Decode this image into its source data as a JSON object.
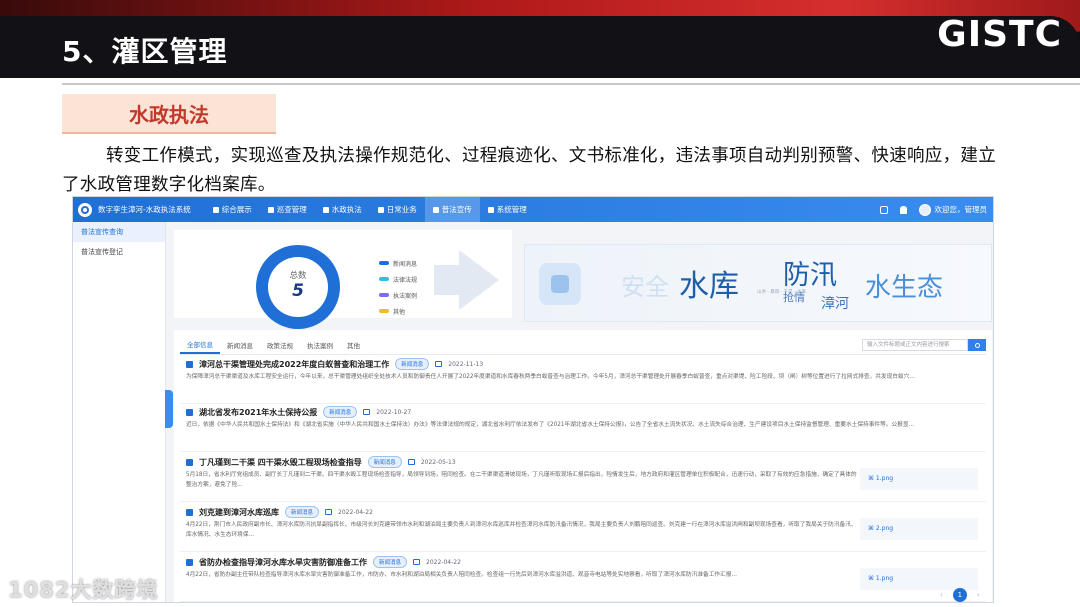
{
  "slide": {
    "title": "5、灌区管理",
    "logo": "GISTC",
    "section_label": "水政执法",
    "description": "转变工作模式，实现巡查及执法操作规范化、过程痕迹化、文书标准化，违法事项自动判别预警、快速响应，建立了水政管理数字化档案库。",
    "watermark": "1082大数跨境"
  },
  "app": {
    "title": "数字孪生漳河-水政执法系统",
    "nav": [
      {
        "label": "综合展示",
        "icon": "grid-icon"
      },
      {
        "label": "巡查管理",
        "icon": "location-icon"
      },
      {
        "label": "水政执法",
        "icon": "shield-icon"
      },
      {
        "label": "日常业务",
        "icon": "briefcase-icon"
      },
      {
        "label": "普法宣传",
        "icon": "megaphone-icon"
      },
      {
        "label": "系统管理",
        "icon": "gear-icon"
      }
    ],
    "active_nav": 4,
    "user_label": "欢迎您，管理员",
    "sidebar": [
      {
        "label": "普法宣传查询"
      },
      {
        "label": "普法宣传登记"
      }
    ]
  },
  "stats": {
    "total_label": "总数",
    "total_value": "5",
    "legend": [
      {
        "label": "新闻消息",
        "color": "#1f6fd6"
      },
      {
        "label": "法律法规",
        "color": "#3bb8e8"
      },
      {
        "label": "执法案例",
        "color": "#7a6ee8"
      },
      {
        "label": "其他",
        "color": "#f5b82e"
      }
    ]
  },
  "banner": {
    "words": [
      "安全",
      "水库",
      "防汛",
      "山洪 · 暴雨 · 干旱 · 水库",
      "抢情",
      "漳河",
      "水生态"
    ]
  },
  "list": {
    "tabs": [
      "全部信息",
      "新闻消息",
      "政策法规",
      "执法案例",
      "其他"
    ],
    "active_tab": 0,
    "search_placeholder": "输入文件标题或正文内容进行搜索",
    "items": [
      {
        "title": "漳河总干渠管理处完成2022年度白蚁普查和治理工作",
        "tag": "新闻消息",
        "date": "2022-11-13",
        "body": "为保障漳河总干渠渠道及水库工程安全运行，今年以来，总干渠管理处组织全处技术人员和防御责任人开展了2022年度渠道和水库春秋两季白蚁普查与治理工作。今年5月，漳河总干渠管理处开展春季白蚁普查，重点对渠堤、险工险段、坝（闸）树等位置进行了拉网式排查，共发现白蚁穴...",
        "attachment": ""
      },
      {
        "title": "湖北省发布2021年水土保持公报",
        "tag": "新闻消息",
        "date": "2022-10-27",
        "body": "近日，依据《中华人民共和国水土保持法》和《湖北省实施〈中华人民共和国水土保持法〉办法》等法律法规的规定，湖北省水利厅依法发布了《2021年湖北省水土保持公报》，公告了全省水土流失状况、水土流失综合治理、生产建设项目水土保持监督管理、重要水土保持事件等。公报显...",
        "attachment": ""
      },
      {
        "title": "丁凡瑾到二干渠 四干渠水毁工程现场检查指导",
        "tag": "新闻消息",
        "date": "2022-05-13",
        "body": "5月18日，省水利厅党组成员、副厅长丁凡瑾到二干渠、四干渠水毁工程现场检查指导，局领导到场，陪同检查。在二干渠渠道滑坡现场，丁凡瑾听取现场汇报后指出，险情发生后，地方政府和灌区管理单位积极配合，迅速行动，采取了有效的应急措施，确定了具体的整治方案，避免了险...",
        "attachment": "1.png"
      },
      {
        "title": "刘克建到漳河水库巡库",
        "tag": "新闻消息",
        "date": "2022-04-22",
        "body": "4月22日，荆门市人民政府副市长、漳河水库防汛抗旱副指挥长、市级河长刘克建带领市水利和湖泊局主要负责人到漳河水库巡库并检查漳河水库防汛备汛情况，我局主要负责人刘鹏陪同巡查。刘克建一行在漳河水库溢洪闸和副坝现场查看，听取了我局关于防汛备汛、库水情况、水生态环境保...",
        "attachment": "2.png"
      },
      {
        "title": "省防办检查指导漳河水库水旱灾害防御准备工作",
        "tag": "新闻消息",
        "date": "2022-04-22",
        "body": "4月22日，省防办副主任带队检查指导漳河水库水旱灾害防御准备工作，市防办、市水利和湖泊局相关负责人陪同检查。检查组一行先后到漳河水库溢洪道、观音寺电站等处实地察看，听取了漳河水库防汛准备工作汇报...",
        "attachment": "1.png"
      }
    ]
  },
  "pager": {
    "current": "1"
  }
}
